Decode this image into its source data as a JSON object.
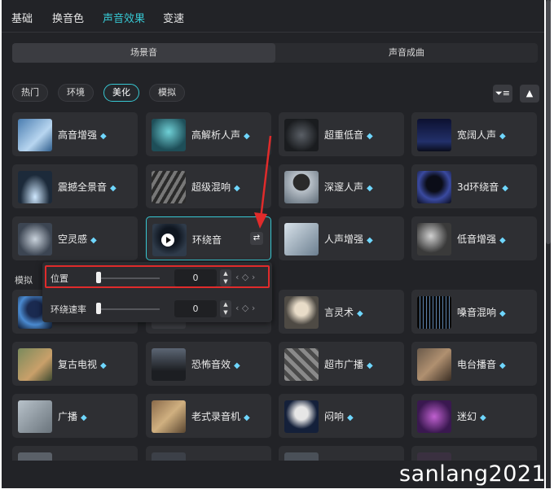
{
  "tabs": [
    "基础",
    "换音色",
    "声音效果",
    "变速"
  ],
  "active_tab": "声音效果",
  "segment": {
    "left": "场景音",
    "right": "声音成曲"
  },
  "chips": [
    "热门",
    "环境",
    "美化",
    "模拟"
  ],
  "active_chip": "美化",
  "section_label": "模拟",
  "cards": [
    {
      "label": "高音增强"
    },
    {
      "label": "高解析人声"
    },
    {
      "label": "超重低音"
    },
    {
      "label": "宽阔人声"
    },
    {
      "label": "震撼全景音"
    },
    {
      "label": "超级混响"
    },
    {
      "label": "深邃人声"
    },
    {
      "label": "3d环绕音"
    },
    {
      "label": "空灵感"
    },
    {
      "label": "环绕音"
    },
    {
      "label": "人声增强"
    },
    {
      "label": "低音增强"
    },
    {
      "label": ""
    },
    {
      "label": ""
    },
    {
      "label": "言灵术"
    },
    {
      "label": "嗓音混响"
    },
    {
      "label": "复古电视"
    },
    {
      "label": "恐怖音效"
    },
    {
      "label": "超市广播"
    },
    {
      "label": "电台播音"
    },
    {
      "label": "广播"
    },
    {
      "label": "老式录音机"
    },
    {
      "label": "闷响"
    },
    {
      "label": "迷幻"
    }
  ],
  "popup": {
    "rows": [
      {
        "label": "位置",
        "value": "0",
        "level": 0
      },
      {
        "label": "环绕速率",
        "value": "0",
        "level": 0
      }
    ]
  },
  "watermark": "sanlang2021",
  "colors": {
    "accent": "#37c7d2",
    "highlight": "#e02b2b",
    "panel": "#222327"
  }
}
